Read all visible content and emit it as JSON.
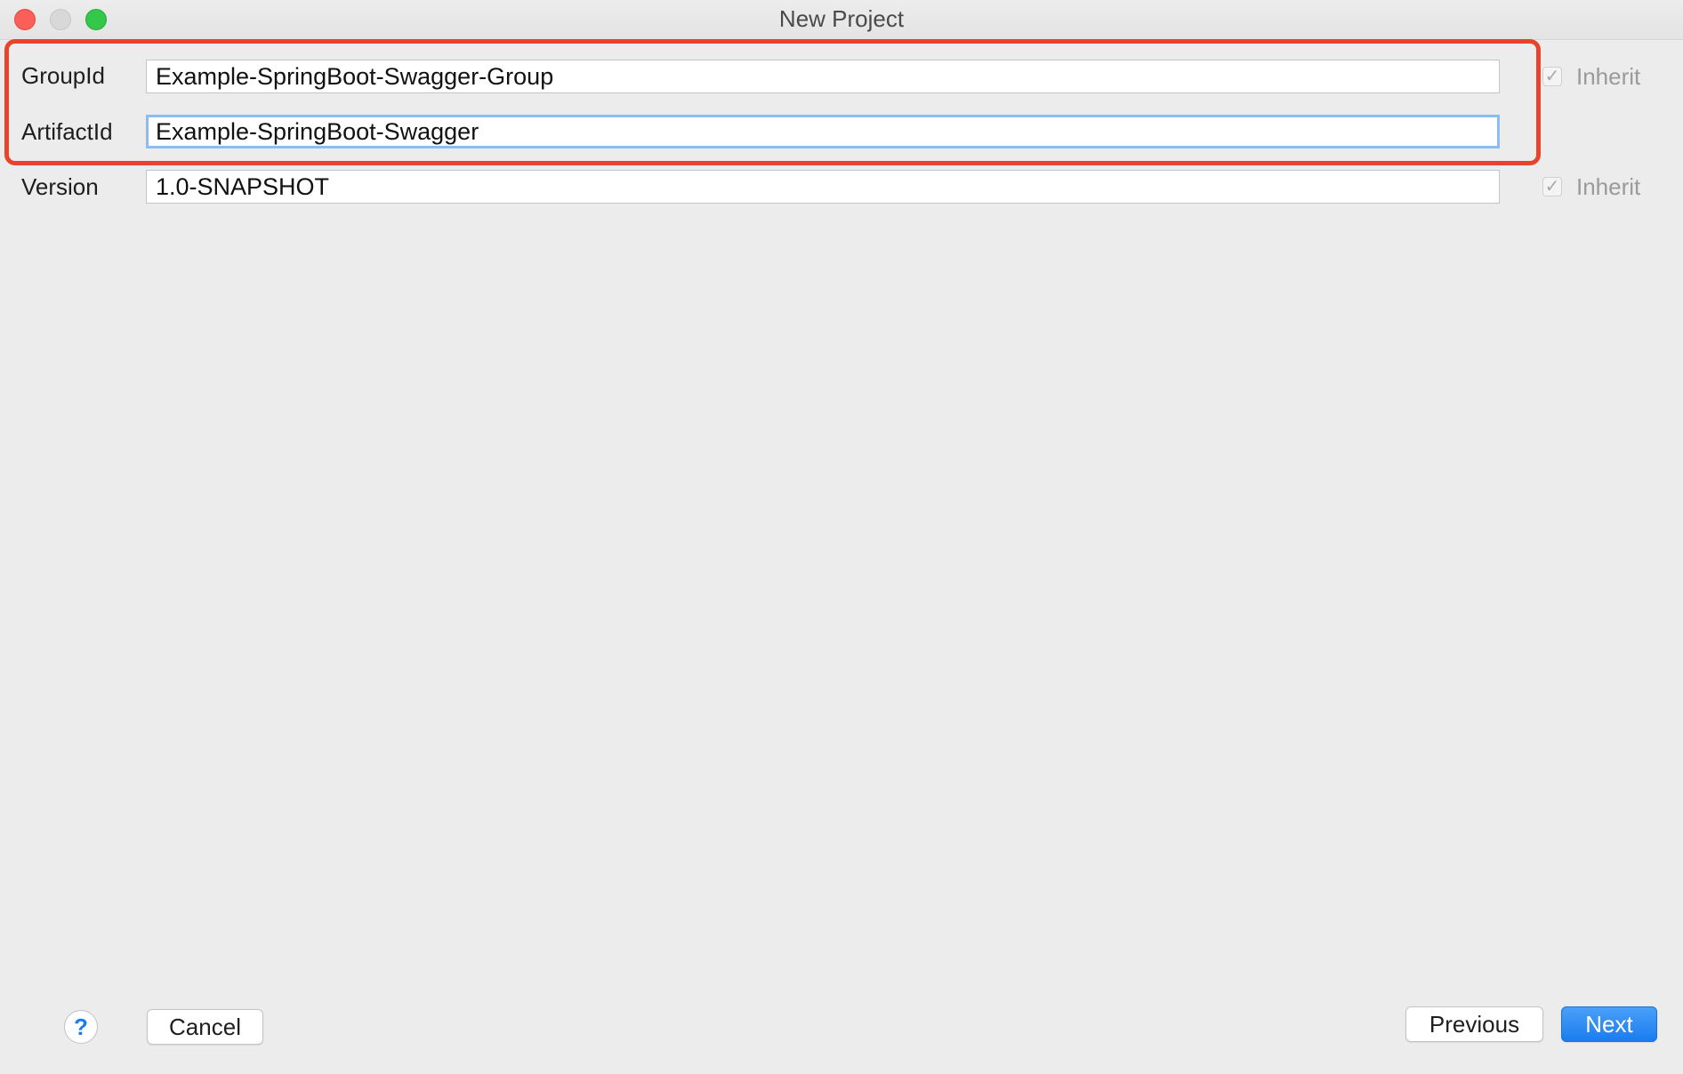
{
  "window": {
    "title": "New Project"
  },
  "form": {
    "group_id": {
      "label": "GroupId",
      "value": "Example-SpringBoot-Swagger-Group",
      "inherit_label": "Inherit",
      "inherit_checked": true
    },
    "artifact_id": {
      "label": "ArtifactId",
      "value": "Example-SpringBoot-Swagger"
    },
    "version": {
      "label": "Version",
      "value": "1.0-SNAPSHOT",
      "inherit_label": "Inherit",
      "inherit_checked": true
    }
  },
  "footer": {
    "help_label": "?",
    "cancel_label": "Cancel",
    "previous_label": "Previous",
    "next_label": "Next"
  },
  "colors": {
    "highlight": "#e8442c",
    "accent": "#1a7cf0",
    "focus_ring": "#8dbdf0"
  },
  "icons": {
    "close": "close-icon",
    "minimize": "minimize-icon",
    "zoom": "zoom-icon",
    "checkmark": "checkmark-icon",
    "help": "help-icon"
  }
}
